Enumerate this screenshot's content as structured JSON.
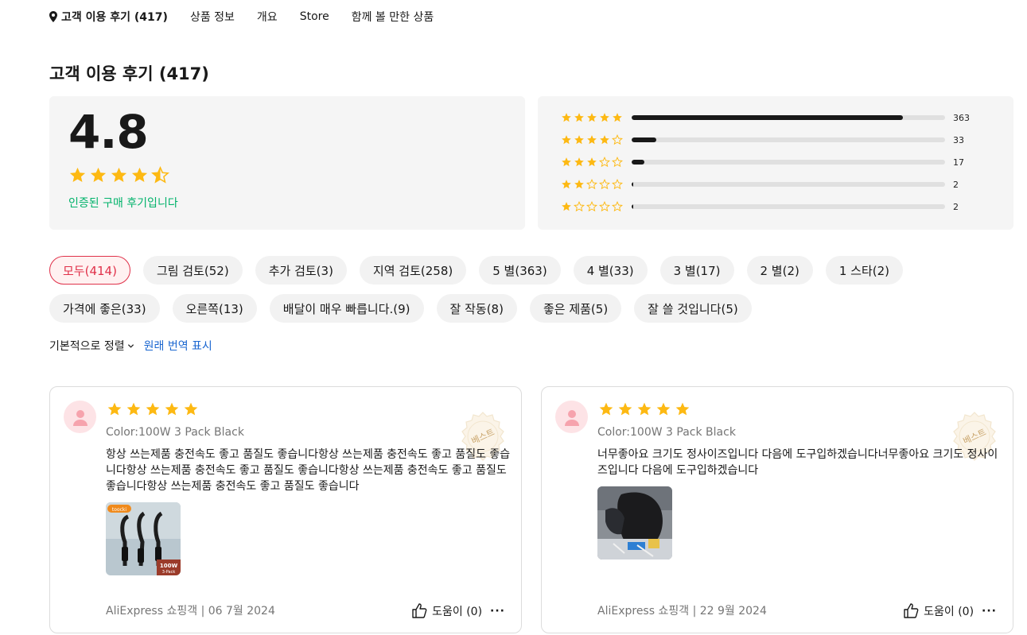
{
  "nav": {
    "reviews": "고객 이용 후기 (417)",
    "product_info": "상품 정보",
    "overview": "개요",
    "store": "Store",
    "related": "함께 볼 만한 상품"
  },
  "page_title": "고객 이용 후기 (417)",
  "summary": {
    "average": "4.8",
    "average_value": 4.8,
    "verified_text": "인증된 구매 후기입니다",
    "distribution": [
      {
        "stars": 5,
        "count": "363",
        "fraction": 0.866
      },
      {
        "stars": 4,
        "count": "33",
        "fraction": 0.079
      },
      {
        "stars": 3,
        "count": "17",
        "fraction": 0.041
      },
      {
        "stars": 2,
        "count": "2",
        "fraction": 0.005
      },
      {
        "stars": 1,
        "count": "2",
        "fraction": 0.005
      }
    ]
  },
  "filters_row1": [
    {
      "label": "모두(414)",
      "active": true
    },
    {
      "label": "그림 검토(52)"
    },
    {
      "label": "추가 검토(3)"
    },
    {
      "label": "지역 검토(258)"
    },
    {
      "label": "5 별(363)"
    },
    {
      "label": "4 별(33)"
    },
    {
      "label": "3 별(17)"
    },
    {
      "label": "2 별(2)"
    },
    {
      "label": "1 스타(2)"
    }
  ],
  "filters_row2": [
    {
      "label": "가격에 좋은(33)"
    },
    {
      "label": "오른쪽(13)"
    },
    {
      "label": "배달이 매우 빠릅니다.(9)"
    },
    {
      "label": "잘 작동(8)"
    },
    {
      "label": "좋은 제품(5)"
    },
    {
      "label": "잘 쓸 것입니다(5)"
    }
  ],
  "sort": {
    "label": "기본적으로 정렬",
    "show_original": "원래 번역 표시"
  },
  "reviews": [
    {
      "rating": 5,
      "badge": "베스트",
      "sku": "Color:100W 3 Pack Black",
      "text": "항상 쓰는제품 충전속도 좋고 품질도 좋습니다항상 쓰는제품 충전속도 좋고 품질도 좋습니다항상 쓰는제품 충전속도 좋고 품질도 좋습니다항상 쓰는제품 충전속도 좋고 품질도 좋습니다항상 쓰는제품 충전속도 좋고 품질도 좋습니다",
      "image_brand": "toocki",
      "image_caption": "100W",
      "image_caption2": "3-Pack",
      "footer": "AliExpress 쇼핑객 | 06 7월 2024",
      "helpful": "도움이 (0)",
      "more": "···"
    },
    {
      "rating": 5,
      "badge": "베스트",
      "sku": "Color:100W 3 Pack Black",
      "text": "너무좋아요 크기도 정사이즈입니다 다음에 도구입하겠습니다너무좋아요 크기도 정사이즈입니다 다음에 도구입하겠습니다",
      "footer": "AliExpress 쇼핑객 | 22 9월 2024",
      "helpful": "도움이 (0)",
      "more": "···"
    }
  ],
  "colors": {
    "star": "#fdb913",
    "accent": "#e0314a",
    "verified": "#00b26a",
    "link": "#1a66d0"
  }
}
